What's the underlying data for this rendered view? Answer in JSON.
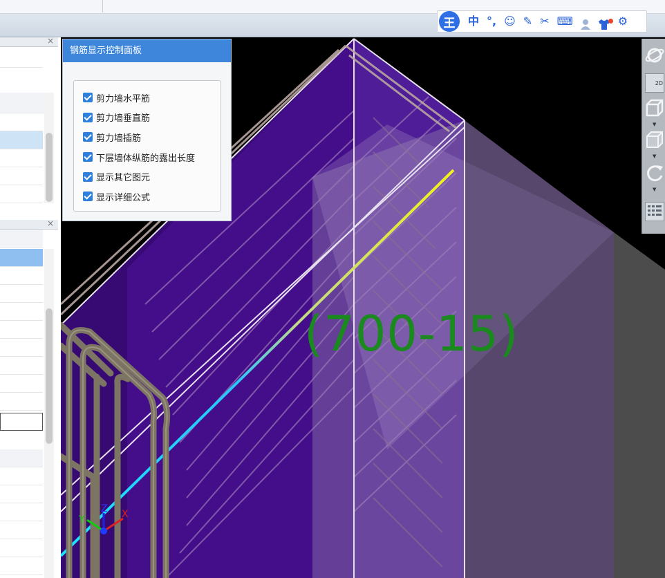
{
  "control_panel": {
    "title": "钢筋显示控制面板",
    "options": [
      {
        "label": "剪力墙水平筋",
        "checked": true
      },
      {
        "label": "剪力墙垂直筋",
        "checked": true
      },
      {
        "label": "剪力墙插筋",
        "checked": true
      },
      {
        "label": "下层墙体纵筋的露出长度",
        "checked": true
      },
      {
        "label": "显示其它图元",
        "checked": true
      },
      {
        "label": "显示详细公式",
        "checked": true
      }
    ]
  },
  "ime_toolbar": {
    "logo": "王",
    "items": [
      {
        "name": "chinese-mode-icon",
        "glyph": "中"
      },
      {
        "name": "punctuation-icon",
        "glyph": "°,"
      },
      {
        "name": "emoji-icon",
        "glyph": "☺"
      },
      {
        "name": "handwriting-icon",
        "glyph": "✎"
      },
      {
        "name": "scissors-icon",
        "glyph": "✂"
      },
      {
        "name": "keyboard-icon",
        "glyph": "⌨"
      },
      {
        "name": "user-icon",
        "glyph": "👤"
      },
      {
        "name": "skin-icon",
        "glyph": "👕"
      },
      {
        "name": "settings-icon",
        "glyph": "⚙"
      }
    ],
    "accent": "#2f6fe6"
  },
  "view_toolbar": {
    "btn_2d_label": "2D"
  },
  "viewport": {
    "dimension_label": "(700-15)",
    "axis_x": "X",
    "axis_y": "Y",
    "axis_z": "Z",
    "label_color": "#1a8a1f",
    "wall_color": "#4b0a8c"
  },
  "panels": {
    "close_glyph": "×"
  }
}
